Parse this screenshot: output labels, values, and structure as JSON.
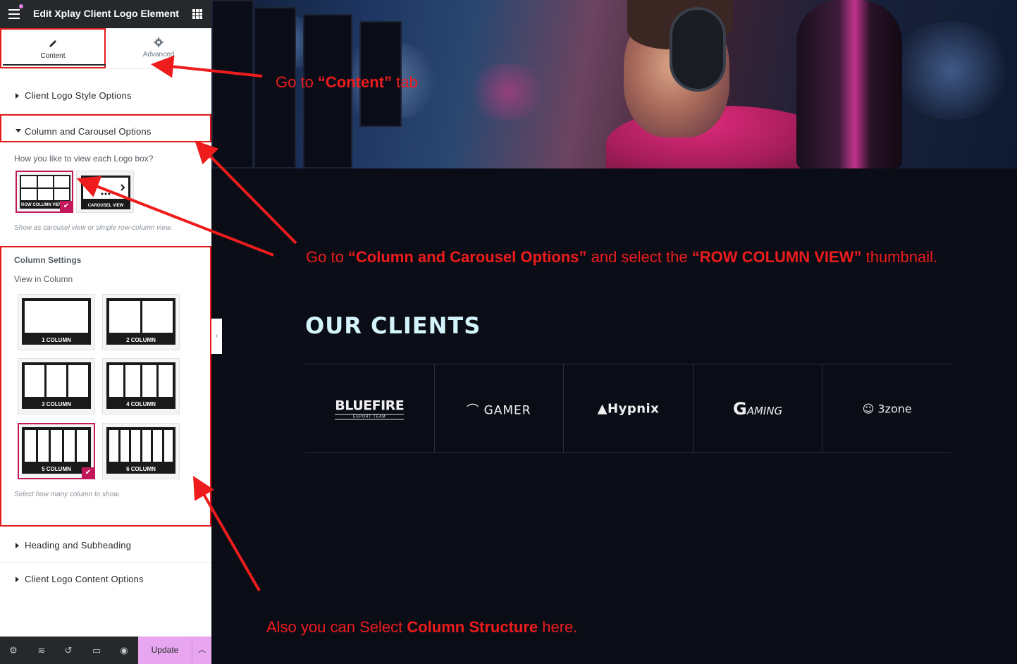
{
  "editor": {
    "title": "Edit Xplay Client Logo Element",
    "tabs": [
      {
        "label": "Content",
        "icon": "pencil-icon"
      },
      {
        "label": "Advanced",
        "icon": "gear-icon"
      }
    ],
    "sections": {
      "client_logo_style": "Client Logo Style Options",
      "column_carousel": "Column and Carousel Options",
      "heading_subheading": "Heading and Subheading",
      "client_logo_content": "Client Logo Content Options"
    },
    "view_field": {
      "label": "How you like to view each Logo box?",
      "options": [
        "ROW COLUMN VIEW",
        "CAROUSEL VIEW"
      ],
      "selected": "ROW COLUMN VIEW",
      "help": "Show as carousel view or simple row-column view."
    },
    "column_settings": {
      "heading": "Column Settings",
      "label": "View in Column",
      "options": [
        "1 COLUMN",
        "2 COLUMN",
        "3 COLUMN",
        "4 COLUMN",
        "5 COLUMN",
        "6 COLUMN"
      ],
      "selected": "5 COLUMN",
      "help": "Select how many column to show."
    },
    "footer": {
      "update_label": "Update",
      "icons": [
        "settings-icon",
        "layers-icon",
        "history-icon",
        "responsive-icon",
        "preview-eye-icon"
      ]
    }
  },
  "preview": {
    "clients_heading": "OUR CLIENTS",
    "logos": {
      "bluefire": {
        "name": "BLUEFIRE",
        "tagline": "ESPORT TEAM"
      },
      "gamer": "GAMER",
      "hypnix": "Hypnix",
      "gaming": {
        "initial": "G",
        "rest": "AMING"
      },
      "bzone": "3zone"
    }
  },
  "annotations": {
    "content_tab": {
      "pre": "Go  to ",
      "bold": "“Content”",
      "post": " tab"
    },
    "column_carousel": {
      "p1": "Go to ",
      "b1": "“Column and Carousel Options”",
      "p2": " and select the ",
      "b2": "“ROW COLUMN VIEW”",
      "p3": " thumbnail."
    },
    "column_structure": {
      "pre": "Also you can Select ",
      "bold": "Column Structure",
      "post": " here."
    }
  },
  "colors": {
    "annotation_red": "#ee1c1c",
    "selected_accent": "#c2185b",
    "update_button": "#e7a6ef",
    "preview_bg": "#0b0d16",
    "heading_text": "#d4f4fb"
  }
}
